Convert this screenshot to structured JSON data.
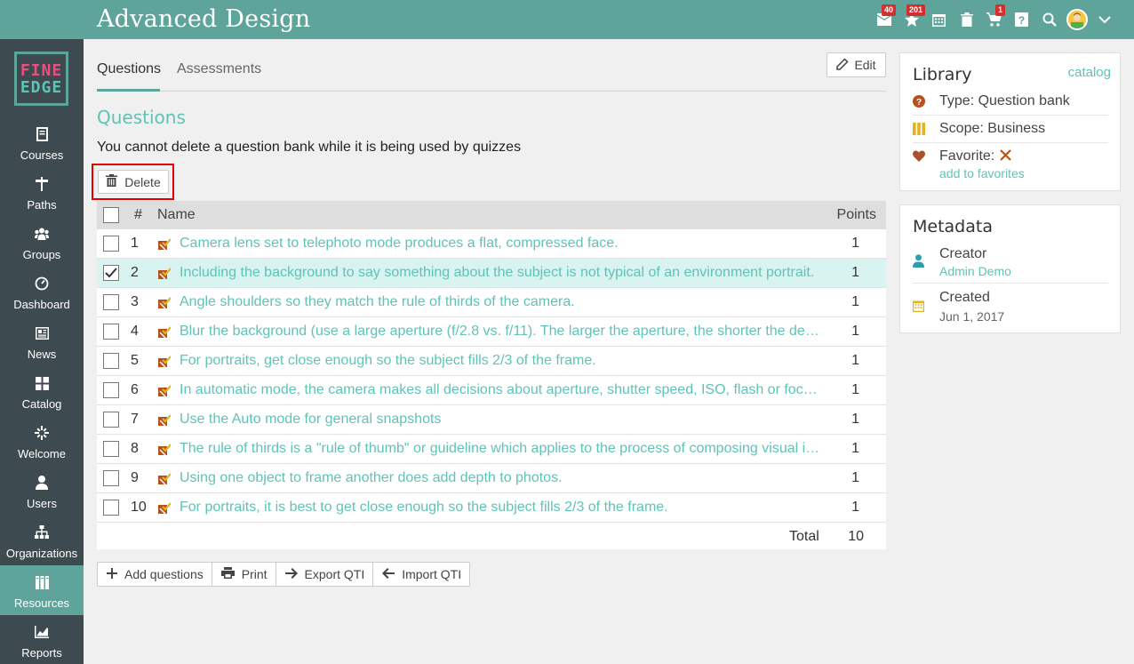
{
  "app": {
    "title": "Advanced Design"
  },
  "topbar": {
    "mail_badge": "40",
    "notifications_badge": "201",
    "cart_badge": "1",
    "icons": [
      "envelope-icon",
      "star-icon",
      "calendar-icon",
      "trash-icon",
      "cart-icon",
      "help-icon",
      "search-icon",
      "avatar",
      "chevron-down-icon"
    ]
  },
  "logo": {
    "line1": "FINE",
    "line2": "EDGE"
  },
  "sidebar": {
    "items": [
      {
        "label": "Courses",
        "icon": "book-icon"
      },
      {
        "label": "Paths",
        "icon": "signpost-icon"
      },
      {
        "label": "Groups",
        "icon": "group-icon"
      },
      {
        "label": "Dashboard",
        "icon": "gauge-icon"
      },
      {
        "label": "News",
        "icon": "newspaper-icon"
      },
      {
        "label": "Catalog",
        "icon": "grid-icon"
      },
      {
        "label": "Welcome",
        "icon": "sparkle-icon"
      },
      {
        "label": "Users",
        "icon": "user-icon"
      },
      {
        "label": "Organizations",
        "icon": "org-chart-icon"
      },
      {
        "label": "Resources",
        "icon": "books-icon",
        "active": true
      },
      {
        "label": "Reports",
        "icon": "chart-icon"
      }
    ]
  },
  "tabs": [
    {
      "label": "Questions",
      "active": true
    },
    {
      "label": "Assessments",
      "active": false
    }
  ],
  "edit_label": "Edit",
  "section_title": "Questions",
  "notice": "You cannot delete a question bank while it is being used by quizzes",
  "delete_label": "Delete",
  "table": {
    "headers": {
      "num": "#",
      "name": "Name",
      "points": "Points"
    },
    "rows": [
      {
        "num": "1",
        "name": "Camera lens set to telephoto mode produces a flat, compressed face.",
        "points": "1",
        "checked": false
      },
      {
        "num": "2",
        "name": "Including the background to say something about the subject is not typical of an environment portrait.",
        "points": "1",
        "checked": true
      },
      {
        "num": "3",
        "name": "Angle shoulders so they match the rule of thirds of the camera.",
        "points": "1",
        "checked": false
      },
      {
        "num": "4",
        "name": "Blur the background (use a large aperture (f/2.8 vs. f/11). The larger the aperture, the shorter the depth of field.",
        "points": "1",
        "checked": false
      },
      {
        "num": "5",
        "name": "For portraits, get close enough so the subject fills 2/3 of the frame.",
        "points": "1",
        "checked": false
      },
      {
        "num": "6",
        "name": "In automatic mode, the camera makes all decisions about aperture, shutter speed, ISO, flash or focus.",
        "points": "1",
        "checked": false
      },
      {
        "num": "7",
        "name": "Use the Auto mode for general snapshots",
        "points": "1",
        "checked": false
      },
      {
        "num": "8",
        "name": "The rule of thirds is a \"rule of thumb\" or guideline which applies to the process of composing visual images.",
        "points": "1",
        "checked": false
      },
      {
        "num": "9",
        "name": "Using one object to frame another does add depth to photos.",
        "points": "1",
        "checked": false
      },
      {
        "num": "10",
        "name": "For portraits, it is best to get close enough so the subject fills 2/3 of the frame.",
        "points": "1",
        "checked": false
      }
    ],
    "total_label": "Total",
    "total_value": "10"
  },
  "bottom_toolbar": {
    "add": "Add questions",
    "print": "Print",
    "export": "Export QTI",
    "import": "Import QTI"
  },
  "library": {
    "title": "Library",
    "link": "catalog",
    "type": "Type: Question bank",
    "scope": "Scope: Business",
    "favorite": "Favorite:",
    "add_favorites": "add to favorites"
  },
  "metadata": {
    "title": "Metadata",
    "creator_label": "Creator",
    "creator_value": "Admin Demo",
    "created_label": "Created",
    "created_value": "Jun 1, 2017"
  },
  "colors": {
    "teal": "#5fa49b",
    "accent_text": "#5fc3b6",
    "sidebar": "#3d4a4f",
    "highlight": "#e00000"
  }
}
